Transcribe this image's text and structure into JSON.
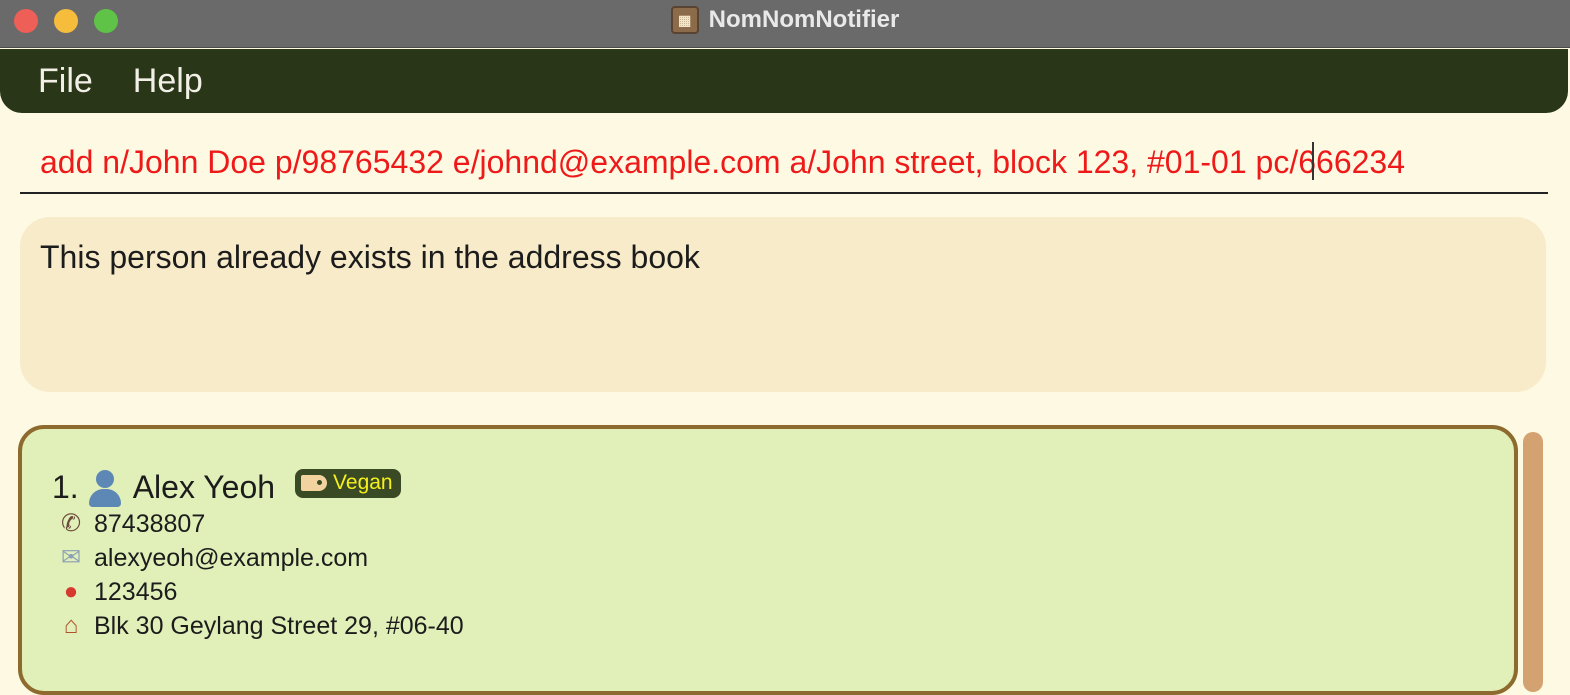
{
  "window": {
    "title": "NomNomNotifier"
  },
  "menu": {
    "items": [
      "File",
      "Help"
    ]
  },
  "command": {
    "value": "add n/John Doe p/98765432 e/johnd@example.com a/John street, block 123, #01-01 pc/666234"
  },
  "result": {
    "message": "This person already exists in the address book"
  },
  "person_list": {
    "cards": [
      {
        "index": "1.",
        "name": "Alex Yeoh",
        "tag": "Vegan",
        "phone": "87438807",
        "email": "alexyeoh@example.com",
        "postal_code": "123456",
        "address": "Blk 30 Geylang Street 29, #06-40",
        "icons": {
          "person": "person-icon",
          "tag": "tag-icon",
          "phone": "phone-icon",
          "email": "email-icon",
          "postal": "pin-icon",
          "address": "house-icon"
        }
      }
    ]
  },
  "colors": {
    "background": "#fdf9e3",
    "menubar": "#293618",
    "command_text": "#ee1a1a",
    "result_bg": "#f8ebc9",
    "card_bg": "#e1efb9",
    "card_border": "#8d6a2d",
    "tag_bg": "#3a4a25",
    "tag_text": "#f7f01c",
    "scrollbar": "#d4a270"
  }
}
